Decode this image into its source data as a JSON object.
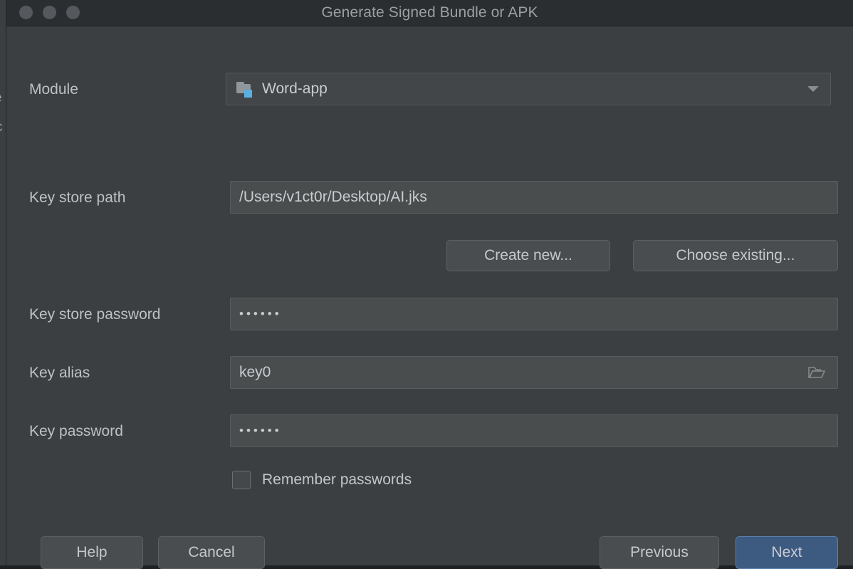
{
  "window": {
    "title": "Generate Signed Bundle or APK",
    "traffic_lights": [
      "close",
      "minimize",
      "zoom"
    ]
  },
  "backdrop": {
    "line1": "e",
    "line2": "c"
  },
  "form": {
    "module": {
      "label": "Module",
      "value": "Word-app",
      "icon": "module-folder-icon",
      "arrow_icon": "chevron-down-icon"
    },
    "keystore_path": {
      "label": "Key store path",
      "value": "/Users/v1ct0r/Desktop/AI.jks",
      "placeholder": ""
    },
    "keystore_actions": {
      "create_new_label": "Create new...",
      "choose_existing_label": "Choose existing..."
    },
    "keystore_password": {
      "label": "Key store password",
      "value": "••••••",
      "placeholder": ""
    },
    "key_alias": {
      "label": "Key alias",
      "value": "key0",
      "placeholder": "",
      "browse_icon": "folder-open-icon"
    },
    "key_password": {
      "label": "Key password",
      "value": "••••••",
      "placeholder": ""
    },
    "remember_passwords": {
      "label": "Remember passwords",
      "checked": false
    }
  },
  "footer": {
    "help_label": "Help",
    "cancel_label": "Cancel",
    "previous_label": "Previous",
    "next_label": "Next"
  },
  "colors": {
    "dialog_background": "#3c3f41",
    "titlebar_background": "#2b2e31",
    "field_background": "#4a4d4e",
    "button_background": "#4a4d4f",
    "accent_button": "#3d5a81",
    "accent_border": "#5a82b0",
    "text_primary": "#c9cdd1",
    "text_label": "#bdc1c5",
    "module_badge": "#59b0e0"
  }
}
